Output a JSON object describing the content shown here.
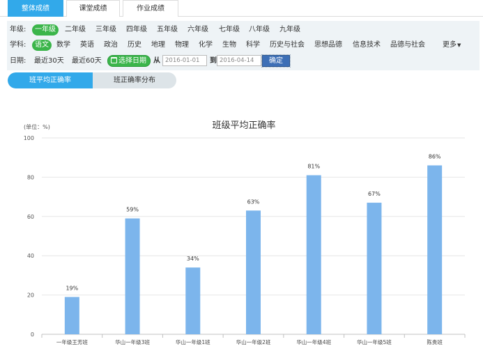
{
  "top_tabs": [
    {
      "label": "整体成绩",
      "active": true
    },
    {
      "label": "课堂成绩",
      "active": false
    },
    {
      "label": "作业成绩",
      "active": false
    }
  ],
  "filters": {
    "grade": {
      "label": "年级:",
      "options": [
        "一年级",
        "二年级",
        "三年级",
        "四年级",
        "五年级",
        "六年级",
        "七年级",
        "八年级",
        "九年级"
      ],
      "selected": "一年级"
    },
    "subject": {
      "label": "学科:",
      "options": [
        "语文",
        "数学",
        "英语",
        "政治",
        "历史",
        "地理",
        "物理",
        "化学",
        "生物",
        "科学",
        "历史与社会",
        "思想品德",
        "信息技术",
        "品德与社会"
      ],
      "selected": "语文",
      "more_label": "更多"
    },
    "date": {
      "label": "日期:",
      "quick_options": [
        "最近30天",
        "最近60天"
      ],
      "select_button": "选择日期",
      "from_label": "从",
      "from_value": "2016-01-01",
      "to_label": "到",
      "to_value": "2016-04-14",
      "confirm_button": "确定"
    }
  },
  "sub_tabs": [
    {
      "label": "班平均正确率",
      "active": true
    },
    {
      "label": "班正确率分布",
      "active": false
    }
  ],
  "colors": {
    "accent": "#32a9ea",
    "active_green": "#3bb54a",
    "bar": "#7cb5ec",
    "confirm": "#3d6fb6"
  },
  "chart_data": {
    "type": "bar",
    "title": "班级平均正确率",
    "unit_label": "(单位：%)",
    "categories": [
      "一年级王芳班",
      "华山一年级3班",
      "华山一年级1班",
      "华山一年级2班",
      "华山一年级4班",
      "华山一年级5班",
      "陈贵班"
    ],
    "values": [
      19,
      59,
      34,
      63,
      81,
      67,
      86
    ],
    "data_labels": [
      "19%",
      "59%",
      "34%",
      "63%",
      "81%",
      "67%",
      "86%"
    ],
    "ylim": [
      0,
      100
    ],
    "yticks": [
      0,
      20,
      40,
      60,
      80,
      100
    ],
    "grid": true,
    "legend": "none"
  }
}
